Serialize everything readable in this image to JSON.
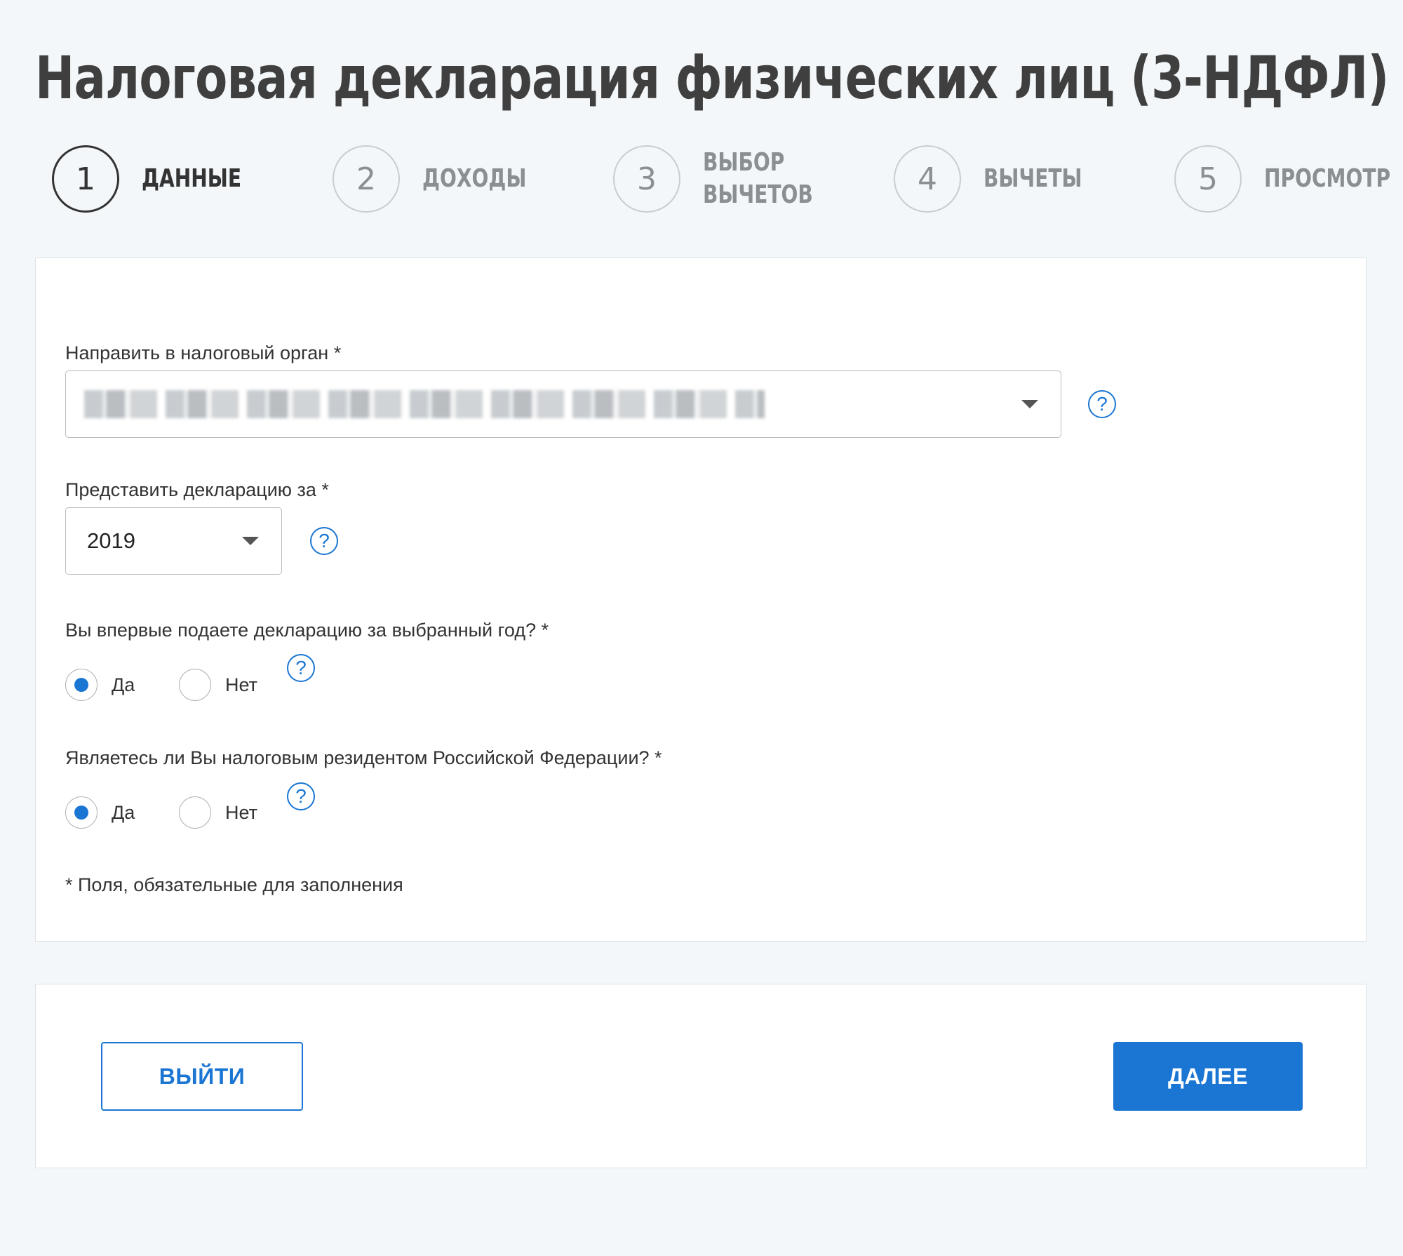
{
  "title": "Налоговая декларация физических лиц (3-НДФЛ)",
  "steps": [
    {
      "number": "1",
      "label_lines": [
        "ДАННЫЕ",
        ""
      ],
      "active": true
    },
    {
      "number": "2",
      "label_lines": [
        "ДОХОДЫ",
        ""
      ],
      "active": false
    },
    {
      "number": "3",
      "label_lines": [
        "ВЫБОР",
        "ВЫЧЕТОВ"
      ],
      "active": false
    },
    {
      "number": "4",
      "label_lines": [
        "ВЫЧЕТЫ",
        ""
      ],
      "active": false
    },
    {
      "number": "5",
      "label_lines": [
        "ПРОСМОТР",
        ""
      ],
      "active": false
    }
  ],
  "form": {
    "tax_office": {
      "label": "Направить в налоговый орган *",
      "help": "?"
    },
    "year": {
      "label": "Представить декларацию за *",
      "value": "2019",
      "help": "?"
    },
    "first_time": {
      "label": "Вы впервые подаете декларацию за выбранный год? *",
      "options": [
        "Да",
        "Нет"
      ],
      "selected": "Да",
      "help": "?"
    },
    "resident": {
      "label": "Являетесь ли Вы налоговым резидентом Российской Федерации? *",
      "options": [
        "Да",
        "Нет"
      ],
      "selected": "Да",
      "help": "?"
    },
    "footnote": "* Поля, обязательные для заполнения"
  },
  "actions": {
    "exit_label": "ВЫЙТИ",
    "next_label": "ДАЛЕЕ"
  },
  "colors": {
    "accent": "#1b76d3",
    "background": "#f3f7f9",
    "text": "#333333"
  },
  "icons": {
    "help": "question-circle-icon",
    "dropdown": "caret-down-icon"
  }
}
